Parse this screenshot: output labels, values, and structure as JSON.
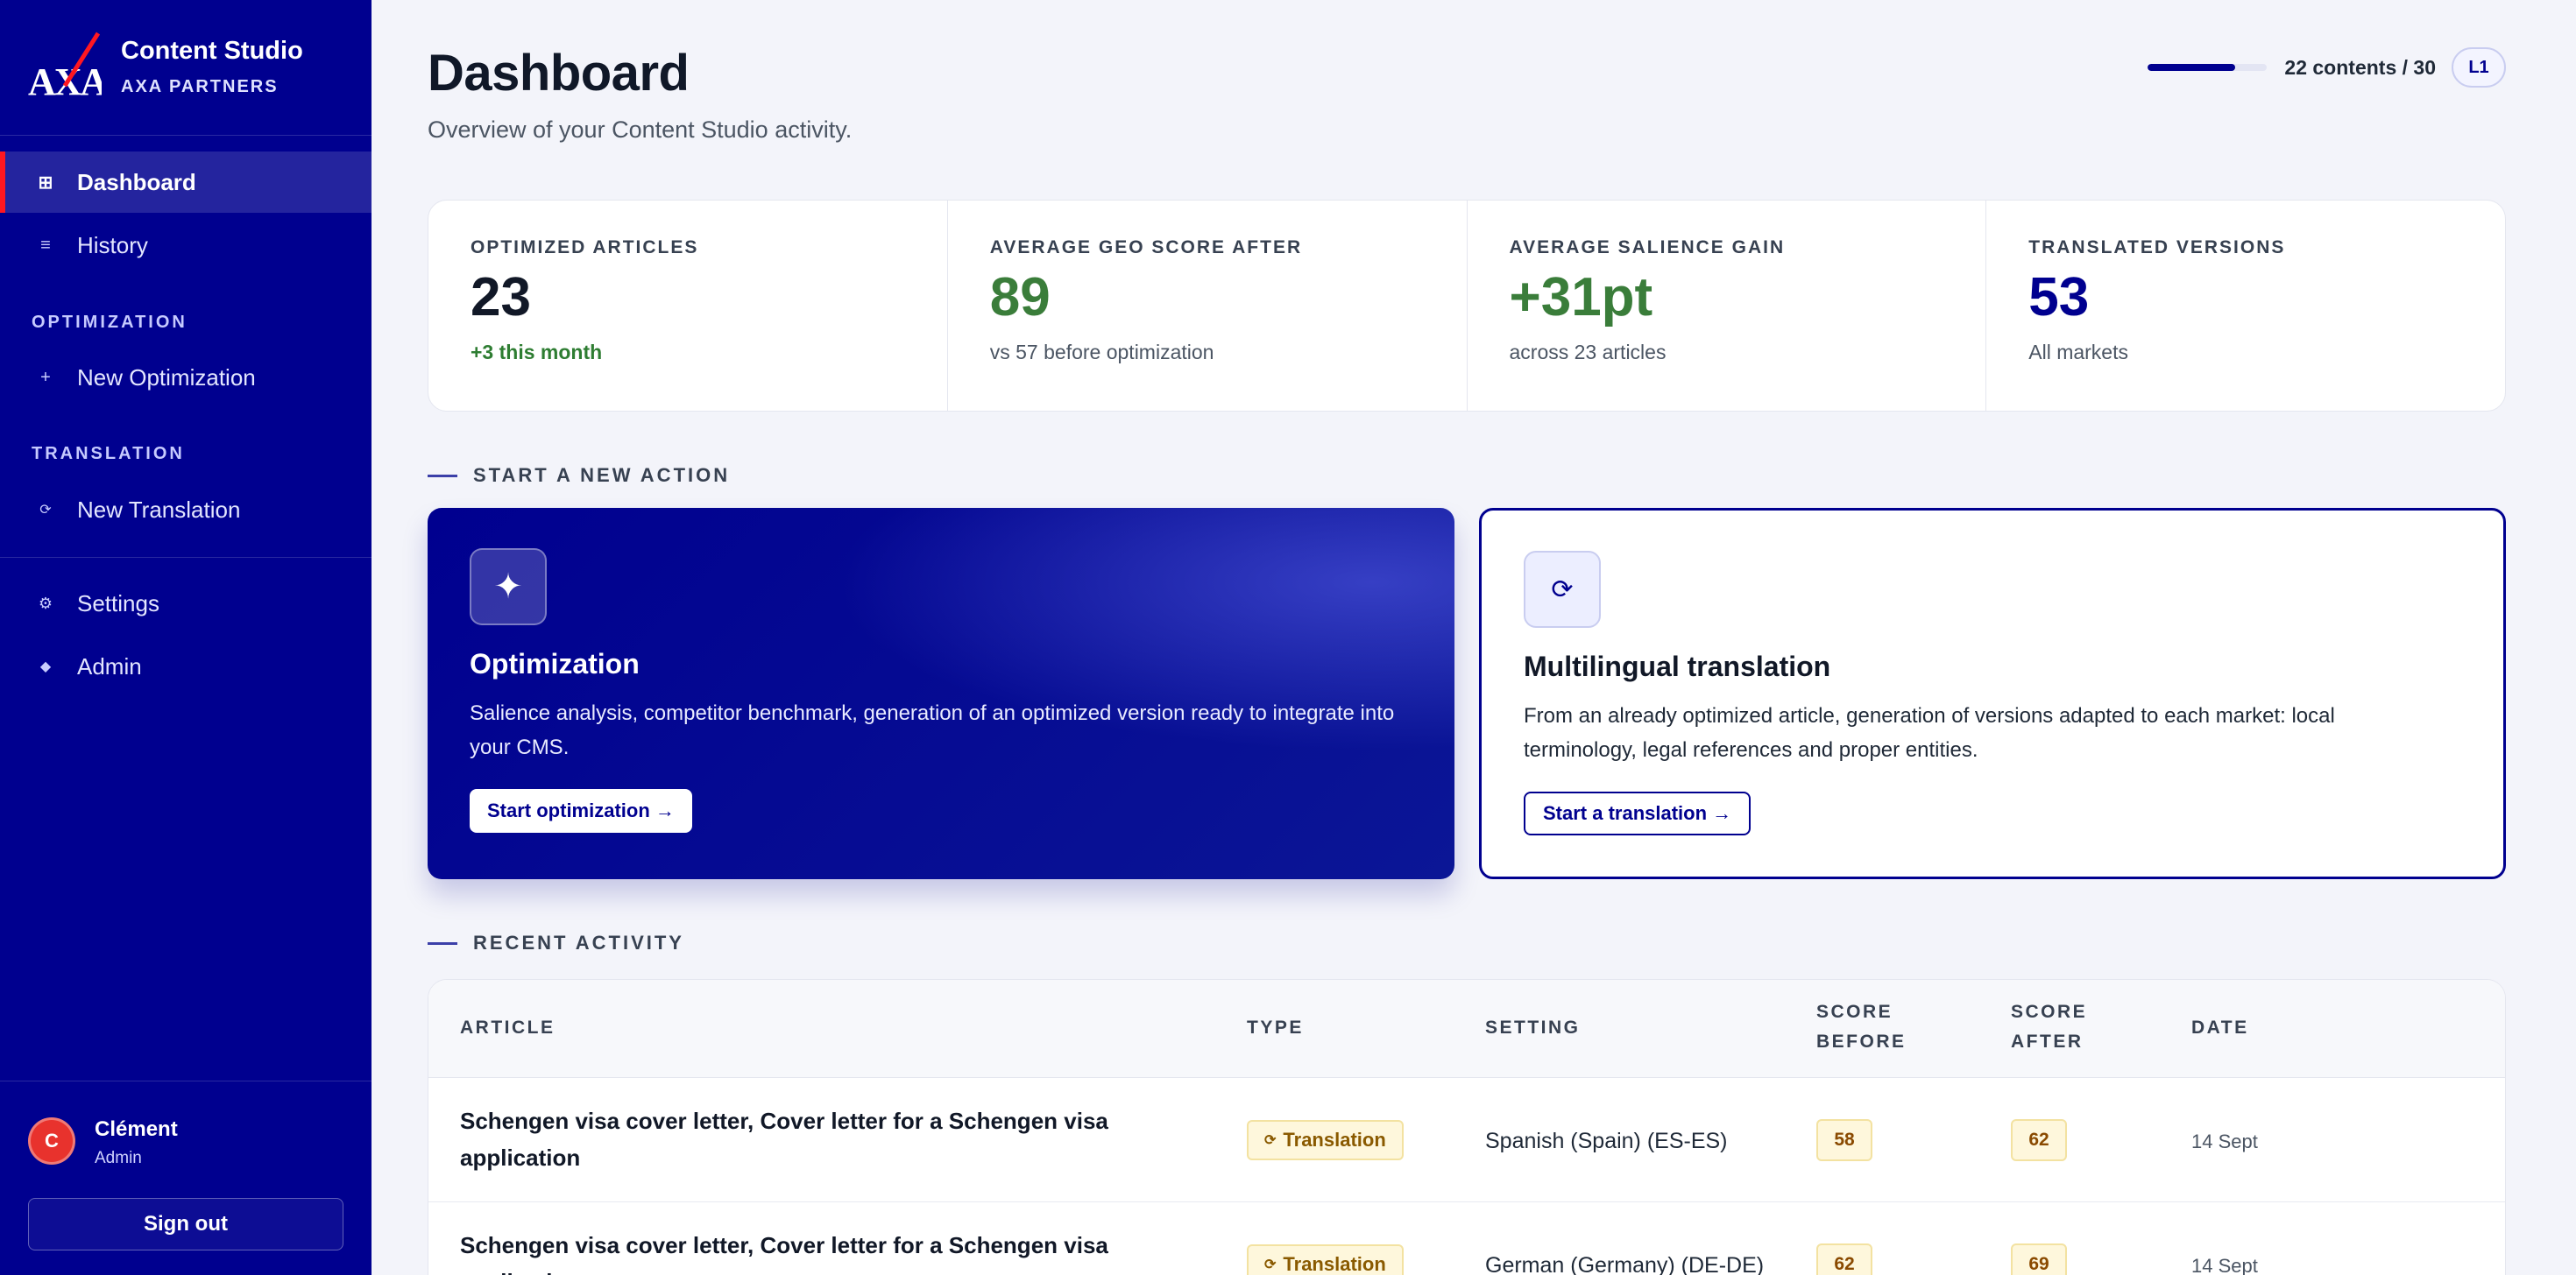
{
  "brand": {
    "name": "Content Studio",
    "subtitle": "AXA PARTNERS"
  },
  "sidebar": {
    "items": [
      {
        "label": "Dashboard",
        "icon": "grid-icon"
      },
      {
        "label": "History",
        "icon": "list-icon"
      }
    ],
    "sections": [
      {
        "title": "OPTIMIZATION",
        "items": [
          {
            "label": "New Optimization",
            "icon": "plus-icon"
          }
        ]
      },
      {
        "title": "TRANSLATION",
        "items": [
          {
            "label": "New Translation",
            "icon": "refresh-icon"
          }
        ]
      }
    ],
    "bottom_items": [
      {
        "label": "Settings",
        "icon": "gear-icon"
      },
      {
        "label": "Admin",
        "icon": "diamond-icon"
      }
    ]
  },
  "user": {
    "initial": "C",
    "name": "Clément",
    "role": "Admin",
    "signout_label": "Sign out"
  },
  "header": {
    "title": "Dashboard",
    "subtitle": "Overview of your Content Studio activity."
  },
  "quota": {
    "text": "22 contents / 30",
    "fraction": 0.733,
    "level": "L1"
  },
  "stats": [
    {
      "label": "OPTIMIZED ARTICLES",
      "value": "23",
      "note": "+3 this month",
      "value_color": "#111827",
      "note_color": "#2e7d32"
    },
    {
      "label": "AVERAGE GEO SCORE AFTER",
      "value": "89",
      "note": "vs 57 before optimization",
      "value_color": "#3a7d3a",
      "note_color": "#4b5563"
    },
    {
      "label": "AVERAGE SALIENCE GAIN",
      "value": "+31pt",
      "note": "across 23 articles",
      "value_color": "#3a7d3a",
      "note_color": "#4b5563"
    },
    {
      "label": "TRANSLATED VERSIONS",
      "value": "53",
      "note": "All markets",
      "value_color": "#00008f",
      "note_color": "#4b5563"
    }
  ],
  "actions": {
    "section_title": "START A NEW ACTION",
    "optimization": {
      "title": "Optimization",
      "description": "Salience analysis, competitor benchmark, generation of an optimized version ready to integrate into your CMS.",
      "button": "Start optimization →",
      "icon": "sparkle-icon"
    },
    "translation": {
      "title": "Multilingual translation",
      "description": "From an already optimized article, generation of versions adapted to each market: local terminology, legal references and proper entities.",
      "button": "Start a translation →",
      "icon": "refresh-icon"
    }
  },
  "activity": {
    "section_title": "RECENT ACTIVITY",
    "columns": {
      "article": "ARTICLE",
      "type": "TYPE",
      "setting": "SETTING",
      "score_before": "SCORE BEFORE",
      "score_after": "SCORE AFTER",
      "date": "DATE"
    },
    "rows": [
      {
        "article": "Schengen visa cover letter, Cover letter for a Schengen visa application",
        "type": "Translation",
        "setting": "Spanish (Spain) (ES-ES)",
        "score_before": "58",
        "score_after": "62",
        "date": "14 Sept"
      },
      {
        "article": "Schengen visa cover letter, Cover letter for a Schengen visa application",
        "type": "Translation",
        "setting": "German (Germany) (DE-DE)",
        "score_before": "62",
        "score_after": "69",
        "date": "14 Sept"
      }
    ]
  }
}
